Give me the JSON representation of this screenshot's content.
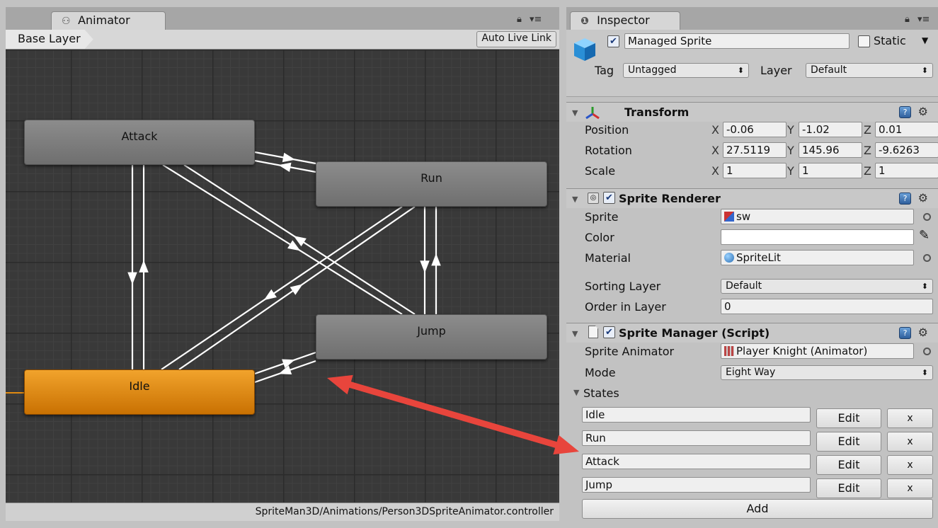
{
  "animator": {
    "tab_label": "Animator",
    "breadcrumb": "Base Layer",
    "auto_live_link": "Auto Live Link",
    "controller_path": "SpriteMan3D/Animations/Person3DSpriteAnimator.controller",
    "states": [
      {
        "name": "Attack",
        "default": false
      },
      {
        "name": "Run",
        "default": false
      },
      {
        "name": "Jump",
        "default": false
      },
      {
        "name": "Idle",
        "default": true
      }
    ]
  },
  "inspector": {
    "tab_label": "Inspector",
    "game_object": {
      "name": "Managed Sprite",
      "active": true,
      "static_label": "Static",
      "static": false,
      "tag_label": "Tag",
      "tag_value": "Untagged",
      "layer_label": "Layer",
      "layer_value": "Default"
    },
    "transform": {
      "title": "Transform",
      "position_label": "Position",
      "rotation_label": "Rotation",
      "scale_label": "Scale",
      "axis_x": "X",
      "axis_y": "Y",
      "axis_z": "Z",
      "position": {
        "x": "-0.06",
        "y": "-1.02",
        "z": "0.01"
      },
      "rotation": {
        "x": "27.5119",
        "y": "145.96",
        "z": "-9.6263"
      },
      "scale": {
        "x": "1",
        "y": "1",
        "z": "1"
      }
    },
    "sprite_renderer": {
      "title": "Sprite Renderer",
      "enabled": true,
      "sprite_label": "Sprite",
      "sprite_value": "sw",
      "color_label": "Color",
      "color_value": "#ffffff",
      "material_label": "Material",
      "material_value": "SpriteLit",
      "sorting_layer_label": "Sorting Layer",
      "sorting_layer_value": "Default",
      "order_label": "Order in Layer",
      "order_value": "0"
    },
    "sprite_manager": {
      "title": "Sprite Manager (Script)",
      "enabled": true,
      "animator_label": "Sprite Animator",
      "animator_value": "Player Knight (Animator)",
      "mode_label": "Mode",
      "mode_value": "Eight Way",
      "states_label": "States",
      "states": [
        "Idle",
        "Run",
        "Attack",
        "Jump"
      ],
      "edit_label": "Edit",
      "remove_label": "x",
      "add_label": "Add"
    }
  },
  "colors": {
    "default_state": "#e08a12",
    "state": "#7d7d7d",
    "graph_bg": "#393939",
    "annotation_arrow": "#e8453c"
  },
  "icons": {
    "animator_tab": "animator-icon",
    "inspector_tab": "info-icon",
    "lock": "lock-icon",
    "window_menu": "menu-icon",
    "transform": "transform-axes-icon",
    "sprite_renderer": "sprite-renderer-icon",
    "script": "script-file-icon",
    "help": "help-book-icon",
    "settings": "gear-icon",
    "color_picker": "eyedropper-icon",
    "object_picker": "target-icon"
  }
}
